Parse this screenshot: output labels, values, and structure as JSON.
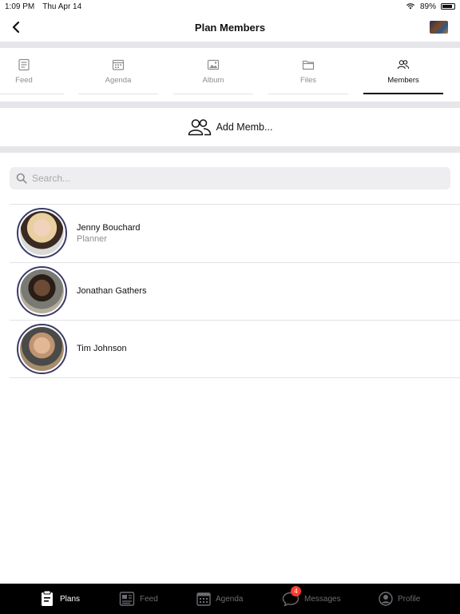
{
  "status": {
    "time": "1:09 PM",
    "date": "Thu Apr 14",
    "battery": "89%"
  },
  "nav": {
    "title": "Plan Members"
  },
  "tabs": [
    {
      "label": "Feed",
      "icon": "newspaper-icon"
    },
    {
      "label": "Agenda",
      "icon": "calendar-icon"
    },
    {
      "label": "Album",
      "icon": "photo-icon"
    },
    {
      "label": "Files",
      "icon": "folder-icon"
    },
    {
      "label": "Members",
      "icon": "people-icon",
      "active": true
    }
  ],
  "add_member": {
    "label": "Add Memb..."
  },
  "search": {
    "placeholder": "Search..."
  },
  "members": [
    {
      "name": "Jenny Bouchard",
      "role": "Planner"
    },
    {
      "name": "Jonathan Gathers",
      "role": ""
    },
    {
      "name": "Tim Johnson",
      "role": ""
    }
  ],
  "bottom_tabs": [
    {
      "label": "Plans",
      "active": true
    },
    {
      "label": "Feed"
    },
    {
      "label": "Agenda"
    },
    {
      "label": "Messages",
      "badge": "4"
    },
    {
      "label": "Profile"
    }
  ]
}
